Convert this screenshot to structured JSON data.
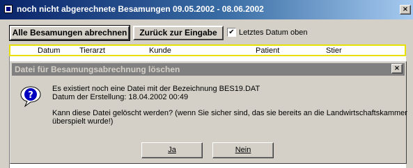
{
  "window": {
    "title": "noch nicht abgerechnete Besamungen 09.05.2002 - 08.06.2002",
    "close_label": "×"
  },
  "toolbar": {
    "bill_all_label": "Alle Besamungen abrechnen",
    "back_label": "Zurück zur Eingabe",
    "latest_date_top_label": "Letztes Datum oben",
    "latest_date_top_checked": true,
    "check_mark": "✔"
  },
  "grid": {
    "columns": [
      "Datum",
      "Tierarzt",
      "Kunde",
      "Patient",
      "Stier"
    ]
  },
  "dialog": {
    "title": "Datei für Besamungsabrechnung löschen",
    "close_label": "×",
    "icon": "question-icon",
    "line1": "Es existiert noch eine Datei mit der Bezeichnung BES19.DAT",
    "line2": "Datum der Erstellung: 18.04.2002 00:49",
    "line3": "Kann diese Datei gelöscht werden? (wenn Sie sicher sind, das sie bereits an die Landwirtschaftskammer",
    "line4": "überspielt wurde!)",
    "yes_label": "Ja",
    "no_label": "Nein"
  },
  "colors": {
    "title_active": "#0a246a",
    "title_inactive": "#808080",
    "window_bg": "#d4d0c8",
    "grid_highlight": "#e8e000"
  }
}
